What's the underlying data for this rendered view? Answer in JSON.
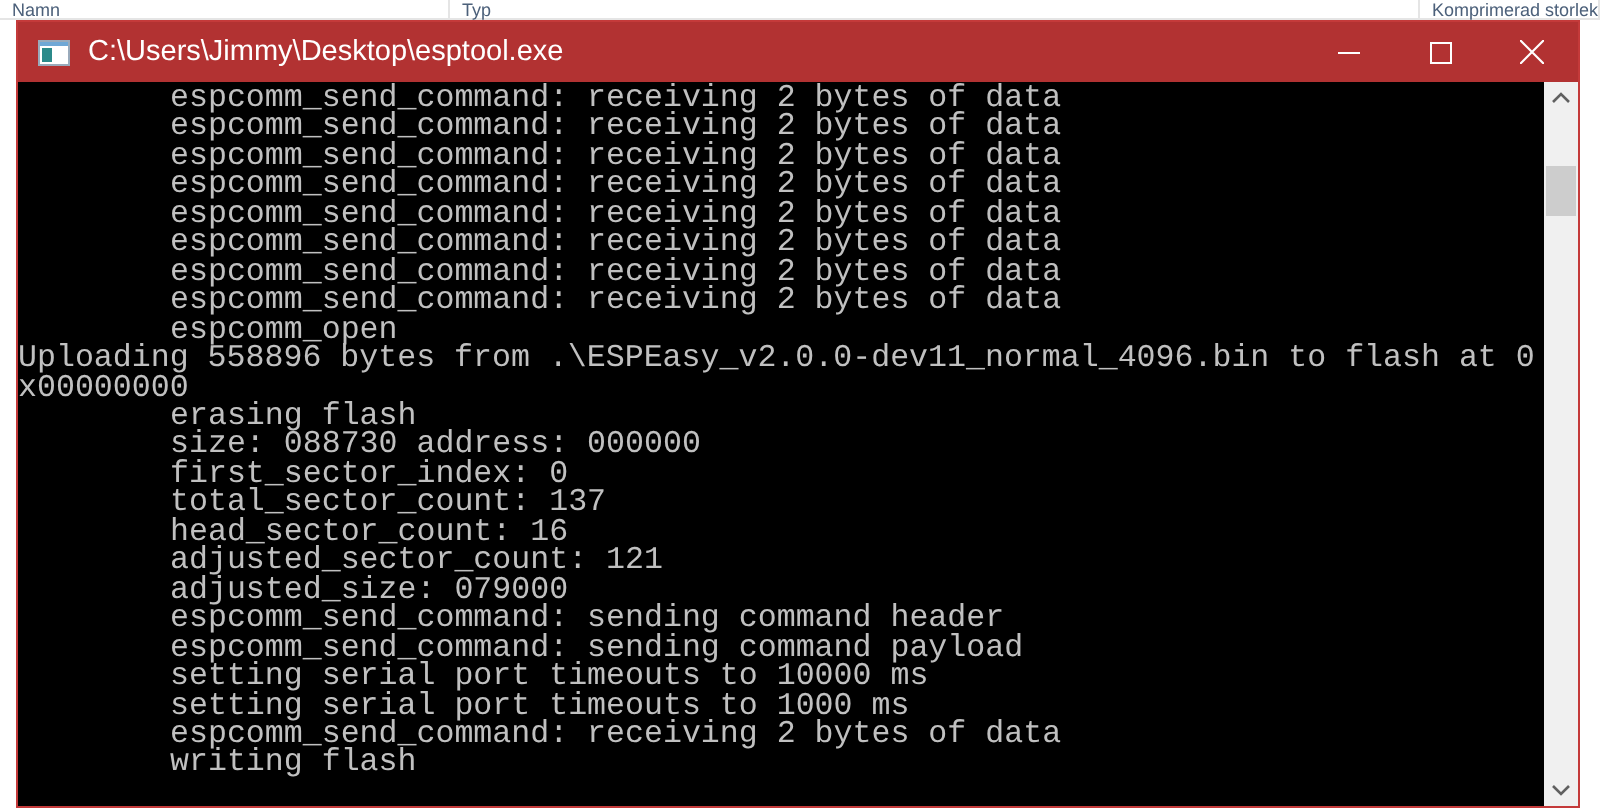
{
  "background_window": {
    "columns": [
      "Namn",
      "Typ",
      "Komprimerad storlek"
    ]
  },
  "window": {
    "title": "C:\\Users\\Jimmy\\Desktop\\esptool.exe"
  },
  "console": {
    "lines": [
      {
        "kind": "indented",
        "text": "espcomm_send_command: receiving 2 bytes of data"
      },
      {
        "kind": "indented",
        "text": "espcomm_send_command: receiving 2 bytes of data"
      },
      {
        "kind": "indented",
        "text": "espcomm_send_command: receiving 2 bytes of data"
      },
      {
        "kind": "indented",
        "text": "espcomm_send_command: receiving 2 bytes of data"
      },
      {
        "kind": "indented",
        "text": "espcomm_send_command: receiving 2 bytes of data"
      },
      {
        "kind": "indented",
        "text": "espcomm_send_command: receiving 2 bytes of data"
      },
      {
        "kind": "indented",
        "text": "espcomm_send_command: receiving 2 bytes of data"
      },
      {
        "kind": "indented",
        "text": "espcomm_send_command: receiving 2 bytes of data"
      },
      {
        "kind": "indented",
        "text": "espcomm_open"
      },
      {
        "kind": "plain",
        "text": "Uploading 558896 bytes from .\\ESPEasy_v2.0.0-dev11_normal_4096.bin to flash at 0"
      },
      {
        "kind": "plain",
        "text": "x00000000"
      },
      {
        "kind": "indented",
        "text": "erasing flash"
      },
      {
        "kind": "indented",
        "text": "size: 088730 address: 000000"
      },
      {
        "kind": "indented",
        "text": "first_sector_index: 0"
      },
      {
        "kind": "indented",
        "text": "total_sector_count: 137"
      },
      {
        "kind": "indented",
        "text": "head_sector_count: 16"
      },
      {
        "kind": "indented",
        "text": "adjusted_sector_count: 121"
      },
      {
        "kind": "indented",
        "text": "adjusted_size: 079000"
      },
      {
        "kind": "indented",
        "text": "espcomm_send_command: sending command header"
      },
      {
        "kind": "indented",
        "text": "espcomm_send_command: sending command payload"
      },
      {
        "kind": "indented",
        "text": "setting serial port timeouts to 10000 ms"
      },
      {
        "kind": "indented",
        "text": "setting serial port timeouts to 1000 ms"
      },
      {
        "kind": "indented",
        "text": "espcomm_send_command: receiving 2 bytes of data"
      },
      {
        "kind": "indented",
        "text": "writing flash"
      }
    ]
  }
}
